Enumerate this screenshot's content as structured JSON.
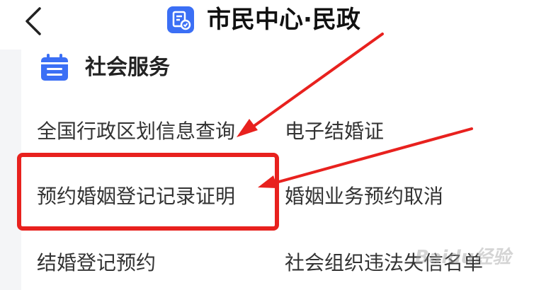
{
  "header": {
    "back_icon": "chevron-left-icon",
    "app_icon": "document-badge-icon",
    "title": "市民中心·民政"
  },
  "section": {
    "icon": "calendar-list-icon",
    "title": "社会服务"
  },
  "services": [
    "全国行政区划信息查询",
    "电子结婚证",
    "预约婚姻登记记录证明",
    "婚姻业务预约取消",
    "结婚登记预约",
    "社会组织违法失信名单"
  ],
  "watermark": "Baidu经验",
  "colors": {
    "accent_blue": "#3b6ff5",
    "annotation_red": "#e8211e"
  }
}
